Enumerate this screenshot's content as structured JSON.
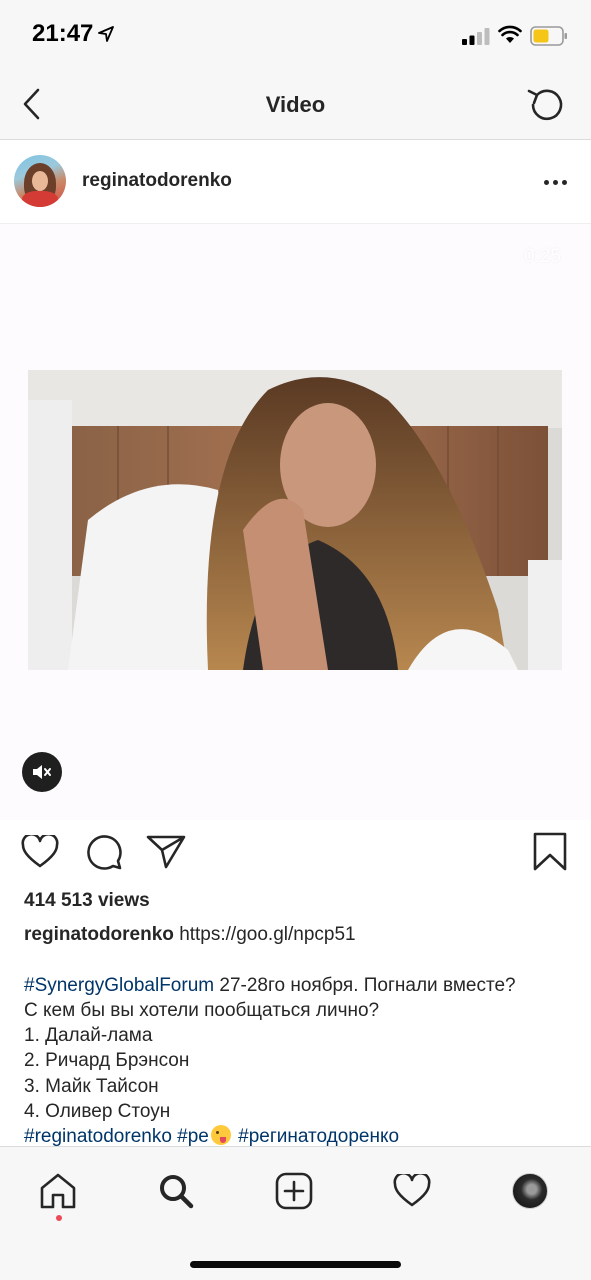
{
  "status_bar": {
    "time": "21:47",
    "icons": [
      "location-arrow-icon",
      "cellular-signal-icon",
      "wifi-icon",
      "battery-icon"
    ],
    "battery_color": "#f5c518"
  },
  "nav": {
    "title": "Video",
    "back_icon": "chevron-left-icon",
    "refresh_icon": "refresh-icon"
  },
  "post": {
    "username": "reginatodorenko",
    "more_icon": "more-horizontal-icon",
    "video_duration": "0:25",
    "muted": true
  },
  "actions": {
    "icons": [
      "heart-icon",
      "comment-icon",
      "share-icon",
      "bookmark-icon"
    ]
  },
  "views": "414 513 views",
  "caption": {
    "username": "reginatodorenko",
    "link": "https://goo.gl/npcp51",
    "hashtag_1": "#SynergyGlobalForum",
    "line_1_rest": " 27-28го ноября. Погнали вместе?",
    "line_2": "С кем бы вы хотели пообщаться лично?",
    "line_3": "1. Далай-лама",
    "line_4": "2. Ричард Брэнсон",
    "line_5": "3. Майк Тайсон",
    "line_6": "4. Оливер Стоун",
    "hashtag_2": "#reginatodorenko",
    "hashtag_3_partial": "#ре",
    "hashtag_4": "#регинатодоренко",
    "tag_color": "#003569"
  },
  "tab_bar": {
    "icons": [
      "home-icon",
      "search-icon",
      "new-post-icon",
      "activity-heart-icon",
      "profile-avatar"
    ],
    "active": "search-icon"
  }
}
